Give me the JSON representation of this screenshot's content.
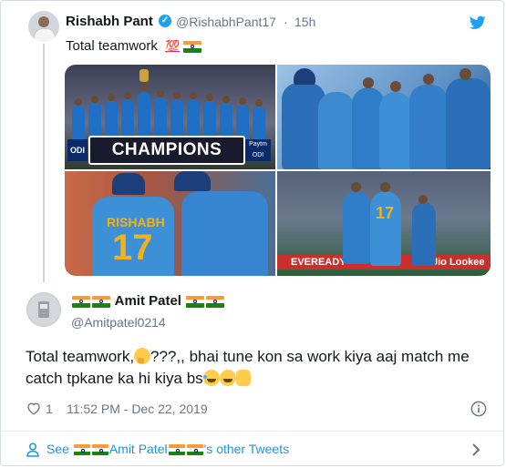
{
  "parent_tweet": {
    "author_name": "Rishabh Pant",
    "handle": "@RishabhPant17",
    "separator": "·",
    "time": "15h",
    "text": "Total teamwork",
    "emoji_100": "💯",
    "images": [
      {
        "banner": "CHAMPIONS",
        "left_badge": "ODI",
        "right_badge": "Paytm ODI"
      },
      {},
      {
        "jersey_name": "RISHABH",
        "jersey_number": "17"
      },
      {
        "board_left": "EVEREADY",
        "board_right": "Jio Lookee",
        "jersey_number": "17"
      }
    ]
  },
  "reply_tweet": {
    "author_name": "Amit Patel",
    "handle": "@Amitpatel0214",
    "text_part1": "Total teamwork,",
    "text_part2": "???,, bhai tune kon sa work kiya aaj match me catch tpkane ka hi kiya bs",
    "likes": "1",
    "timestamp": "11:52 PM - Dec 22, 2019"
  },
  "footer": {
    "see_label": "See",
    "user_name": "Amit Patel",
    "suffix": "'s other Tweets"
  },
  "colors": {
    "link": "#1b95e0",
    "muted": "#657786",
    "verified": "#1da1f2",
    "saffron": "#ff9933",
    "green": "#138808"
  },
  "icons": {
    "logo": "twitter-bird-icon",
    "verified": "verified-badge-icon",
    "like": "heart-icon",
    "info": "info-icon",
    "footer_user": "user-icon",
    "footer_chevron": "chevron-right-icon"
  }
}
